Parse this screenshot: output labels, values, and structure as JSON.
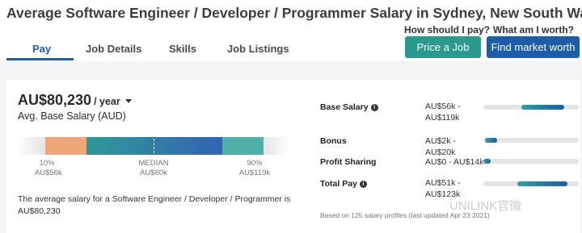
{
  "page_title": "Average Software Engineer / Developer / Programmer Salary in Sydney, New South Wales",
  "tabs": [
    {
      "label": "Pay",
      "active": true
    },
    {
      "label": "Job Details",
      "active": false
    },
    {
      "label": "Skills",
      "active": false
    },
    {
      "label": "Job Listings",
      "active": false
    }
  ],
  "actions": {
    "pay_question": "How should I pay?",
    "worth_question": "What am I worth?",
    "price_job_label": "Price a Job",
    "find_market_label": "Find market worth"
  },
  "summary": {
    "amount": "AU$80,230",
    "period": "/ year",
    "subtitle": "Avg. Base Salary (AUD)",
    "description": "The average salary for a Software Engineer / Developer / Programmer is AU$80,230"
  },
  "range": {
    "low": {
      "pct": "10%",
      "value": "AU$56k"
    },
    "median": {
      "label": "MEDIAN",
      "value": "AU$80k"
    },
    "high": {
      "pct": "90%",
      "value": "AU$119k"
    },
    "colors": {
      "low": "#f0a678",
      "mid_start": "#2e9a98",
      "mid_end": "#3363b5",
      "high": "#4fb0a8"
    }
  },
  "breakdown": [
    {
      "label": "Base Salary",
      "info": true,
      "value": "AU$56k - AU$119k",
      "fill_start": 0.4,
      "fill_end": 0.85
    },
    {
      "label": "Bonus",
      "info": false,
      "value": "AU$2k - AU$20k",
      "fill_start": 0.02,
      "fill_end": 0.14
    },
    {
      "label": "Profit Sharing",
      "info": false,
      "value": "AU$0 - AU$14k",
      "fill_start": 0.0,
      "fill_end": 0.08
    },
    {
      "label": "Total Pay",
      "info": true,
      "value": "AU$51k - AU$123k",
      "fill_start": 0.36,
      "fill_end": 0.88
    }
  ],
  "footnote": "Based on 125 salary profiles (last updated Apr 23 2021)",
  "watermark": "UNILINK官微",
  "icons": {
    "info": "info-circle-icon",
    "caret": "caret-down-icon"
  }
}
